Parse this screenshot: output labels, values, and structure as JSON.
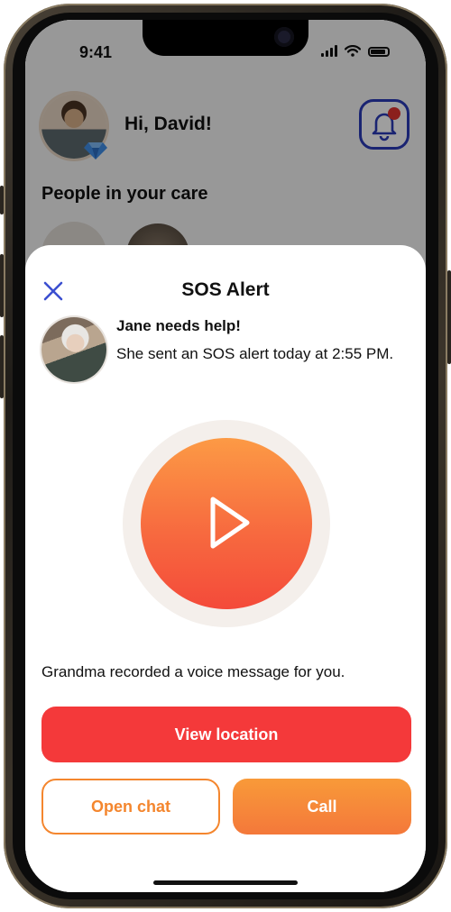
{
  "status_bar": {
    "time": "9:41",
    "wifi_icon": "wifi-icon",
    "signal_icon": "signal-icon",
    "battery_icon": "battery-icon"
  },
  "home": {
    "greeting": "Hi, David!",
    "section_title": "People in your care",
    "notification_icon": "bell-icon",
    "badge_icon": "gem-icon"
  },
  "sos_sheet": {
    "title": "SOS Alert",
    "close_icon": "close-icon",
    "alert_heading": "Jane needs help!",
    "alert_message": "She sent an SOS alert today at 2:55 PM.",
    "play_icon": "play-icon",
    "voice_message_text": "Grandma recorded a voice message for you.",
    "view_location_label": "View location",
    "open_chat_label": "Open chat",
    "call_label": "Call"
  },
  "colors": {
    "accent_red": "#f4393a",
    "accent_orange": "#f4862e",
    "accent_blue": "#2a3bb8"
  }
}
